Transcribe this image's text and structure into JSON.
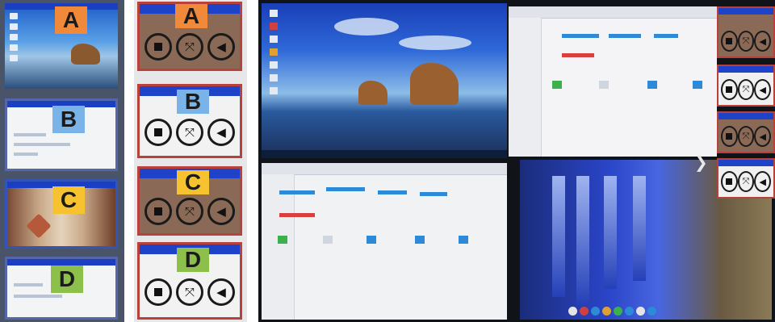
{
  "sources": [
    {
      "label": "A"
    },
    {
      "label": "B"
    },
    {
      "label": "C"
    },
    {
      "label": "D"
    }
  ],
  "controls": [
    {
      "label": "A"
    },
    {
      "label": "B"
    },
    {
      "label": "C"
    },
    {
      "label": "D"
    }
  ],
  "icons": {
    "stop": "stop-icon",
    "fullscreen": "expand-icon",
    "audio": "speaker-icon",
    "next": "chevron-right-icon"
  },
  "colors": {
    "label_a": "#f0893a",
    "label_b": "#79b3e8",
    "label_c": "#f7c230",
    "label_d": "#8cc04a",
    "title_bar": "#1f43c8",
    "control_border": "#b7413b"
  }
}
